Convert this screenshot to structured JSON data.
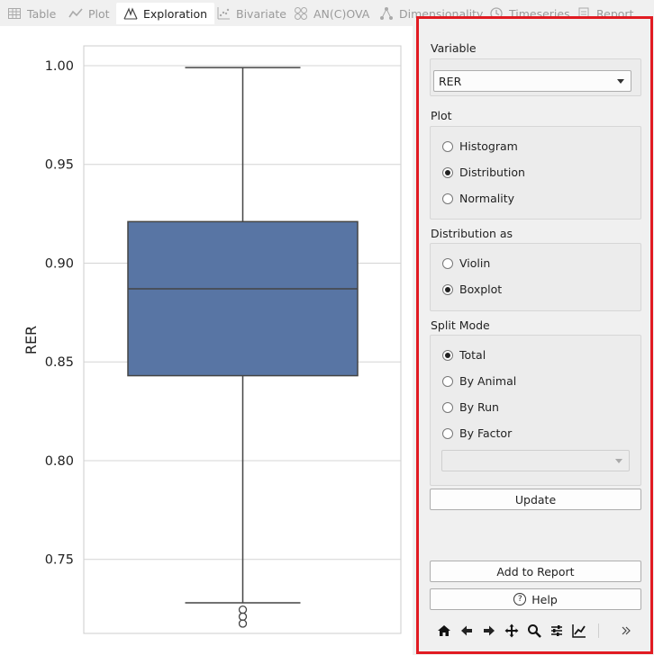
{
  "tabs": [
    {
      "label": "Table",
      "icon": "table-icon",
      "active": false
    },
    {
      "label": "Plot",
      "icon": "line-plot-icon",
      "active": false
    },
    {
      "label": "Exploration",
      "icon": "distribution-icon",
      "active": true
    },
    {
      "label": "Bivariate",
      "icon": "scatter-icon",
      "active": false
    },
    {
      "label": "AN(C)OVA",
      "icon": "anova-icon",
      "active": false
    },
    {
      "label": "Dimensionality",
      "icon": "network-icon",
      "active": false
    },
    {
      "label": "Timeseries",
      "icon": "clock-icon",
      "active": false
    },
    {
      "label": "Report",
      "icon": "report-icon",
      "active": false
    }
  ],
  "chart_data": {
    "type": "box",
    "ylabel": "RER",
    "ylim": [
      0.7125,
      1.01
    ],
    "yticks": [
      "0.75",
      "0.80",
      "0.85",
      "0.90",
      "0.95",
      "1.00"
    ],
    "ytick_values": [
      0.75,
      0.8,
      0.85,
      0.9,
      0.95,
      1.0
    ],
    "grid": true,
    "box": {
      "whisker_low": 0.728,
      "q1": 0.843,
      "median": 0.887,
      "q3": 0.921,
      "whisker_high": 0.999,
      "outliers": [
        0.7245,
        0.721,
        0.7175
      ],
      "color": "#5875a4"
    }
  },
  "panel": {
    "variable_label": "Variable",
    "variable_value": "RER",
    "plot_label": "Plot",
    "plot_options": [
      {
        "label": "Histogram",
        "checked": false
      },
      {
        "label": "Distribution",
        "checked": true
      },
      {
        "label": "Normality",
        "checked": false
      }
    ],
    "dist_label": "Distribution as",
    "dist_options": [
      {
        "label": "Violin",
        "checked": false
      },
      {
        "label": "Boxplot",
        "checked": true
      }
    ],
    "split_label": "Split Mode",
    "split_options": [
      {
        "label": "Total",
        "checked": true
      },
      {
        "label": "By Animal",
        "checked": false
      },
      {
        "label": "By Run",
        "checked": false
      },
      {
        "label": "By Factor",
        "checked": false
      }
    ],
    "factor_value": "",
    "update_label": "Update",
    "add_report_label": "Add to Report",
    "help_label": "Help",
    "toolbar_icons": [
      "home-icon",
      "back-icon",
      "forward-icon",
      "pan-icon",
      "zoom-icon",
      "configure-icon",
      "edit-axis-icon",
      "more-icon"
    ]
  },
  "colors": {
    "panel_border": "#e11b22",
    "box_fill": "#5875a4",
    "accent": "#222222"
  }
}
